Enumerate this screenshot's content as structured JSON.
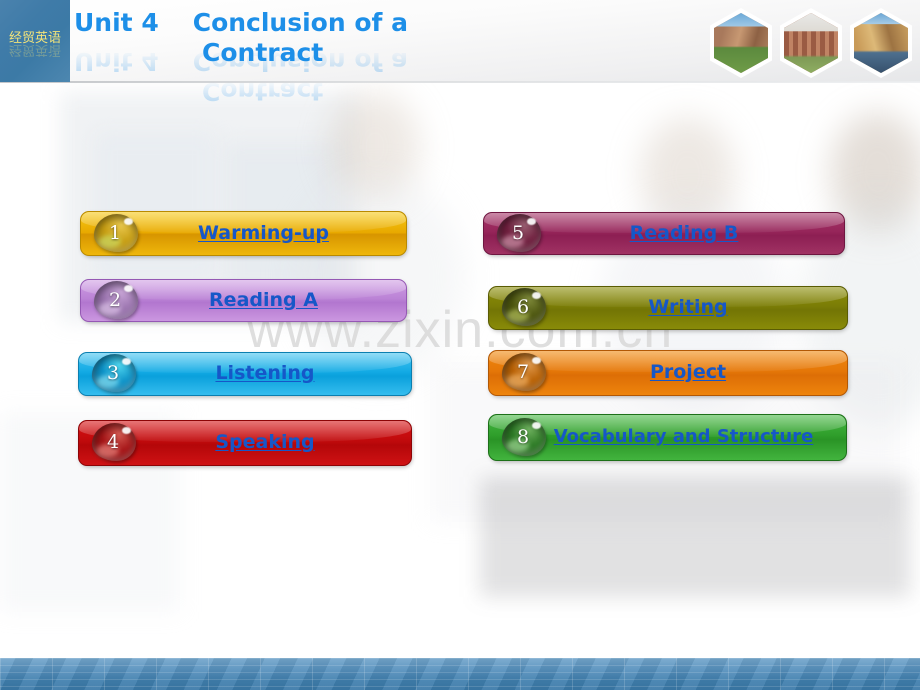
{
  "header": {
    "brand": "经贸英语",
    "unit": "Unit 4",
    "title_line1": "Conclusion of a",
    "title_line2": "Contract",
    "hex_photos": [
      {
        "name": "hex-photo-cathedral-ruins"
      },
      {
        "name": "hex-photo-brick-building"
      },
      {
        "name": "hex-photo-abbey-autumn"
      }
    ]
  },
  "watermark": "www.zixin.com.cn",
  "menu": {
    "left_column": [
      {
        "number": "1",
        "label": "Warming-up",
        "color": "#e8a900",
        "theme": "t-gold"
      },
      {
        "number": "2",
        "label": "Reading A",
        "color": "#bb83d6",
        "theme": "t-purple"
      },
      {
        "number": "3",
        "label": "Listening",
        "color": "#12aae4",
        "theme": "t-cyan"
      },
      {
        "number": "4",
        "label": "Speaking",
        "color": "#c00a0c",
        "theme": "t-red"
      }
    ],
    "right_column": [
      {
        "number": "5",
        "label": "Reading B",
        "color": "#96255a",
        "theme": "t-magenta"
      },
      {
        "number": "6",
        "label": "Writing",
        "color": "#7b7d06",
        "theme": "t-olive"
      },
      {
        "number": "7",
        "label": "Project",
        "color": "#e57708",
        "theme": "t-orange"
      },
      {
        "number": "8",
        "label": "Vocabulary and Structure",
        "color": "#2f9e2b",
        "theme": "t-green"
      }
    ]
  },
  "colors": {
    "link_text": "#1657c8",
    "title_blue": "#1d8fe8",
    "brand_bg": "#3f7ba8",
    "brand_text": "#f2e37a",
    "bottom_bar": "#407fae",
    "watermark": "#d9d9d9"
  }
}
